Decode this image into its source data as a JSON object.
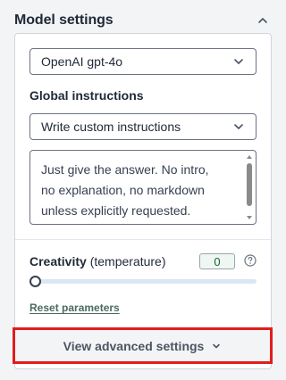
{
  "header": {
    "title": "Model settings",
    "collapse_icon": "chevron-up-icon"
  },
  "model_select": {
    "value": "OpenAI gpt-4o"
  },
  "global_instructions": {
    "label": "Global instructions",
    "select_value": "Write custom instructions",
    "text": "Just give the answer. No intro,\nno explanation, no markdown\nunless explicitly requested."
  },
  "creativity": {
    "label": "Creativity",
    "sublabel": "(temperature)",
    "value": "0",
    "slider_fraction": 0,
    "help_icon": "question-circle-icon"
  },
  "reset_label": "Reset parameters",
  "advanced": {
    "label": "View advanced settings",
    "icon": "chevron-down-icon",
    "highlight_color": "#e11d1d"
  }
}
